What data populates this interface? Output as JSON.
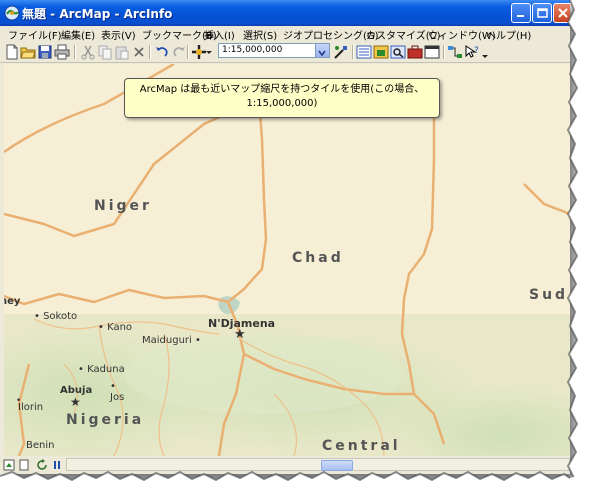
{
  "window": {
    "title": "無題 - ArcMap - ArcInfo"
  },
  "menu": {
    "items": [
      {
        "label": "ファイル(F)"
      },
      {
        "label": "編集(E)"
      },
      {
        "label": "表示(V)"
      },
      {
        "label": "ブックマーク(B)"
      },
      {
        "label": "挿入(I)"
      },
      {
        "label": "選択(S)"
      },
      {
        "label": "ジオプロセシング(G)"
      },
      {
        "label": "カスタマイズ(C)"
      },
      {
        "label": "ウィンドウ(W)"
      },
      {
        "label": "ヘルプ(H)"
      }
    ]
  },
  "toolbar": {
    "scale_value": "1:15,000,000"
  },
  "tooltip": {
    "line1": "ArcMap は最も近いマップ縮尺を持つタイルを使用(この場合、",
    "line2": "1:15,000,000)"
  },
  "map": {
    "countries": {
      "niger": "Niger",
      "chad": "Chad",
      "sudan": "Sud",
      "nigeria": "Nigeria",
      "central": "Central",
      "ney": "ney"
    },
    "cities": {
      "sokoto": "Sokoto",
      "kano": "Kano",
      "ndjamena": "N'Djamena",
      "maiduguri": "Maiduguri",
      "kaduna": "Kaduna",
      "abuja": "Abuja",
      "jos": "Jos",
      "ilorin": "Ilorin",
      "benin": "Benin"
    }
  },
  "colors": {
    "titlebar": "#0a5ee0",
    "map_background": "#f6efd6",
    "border_line": "#e9b071",
    "tooltip_bg": "#ffffc8"
  }
}
